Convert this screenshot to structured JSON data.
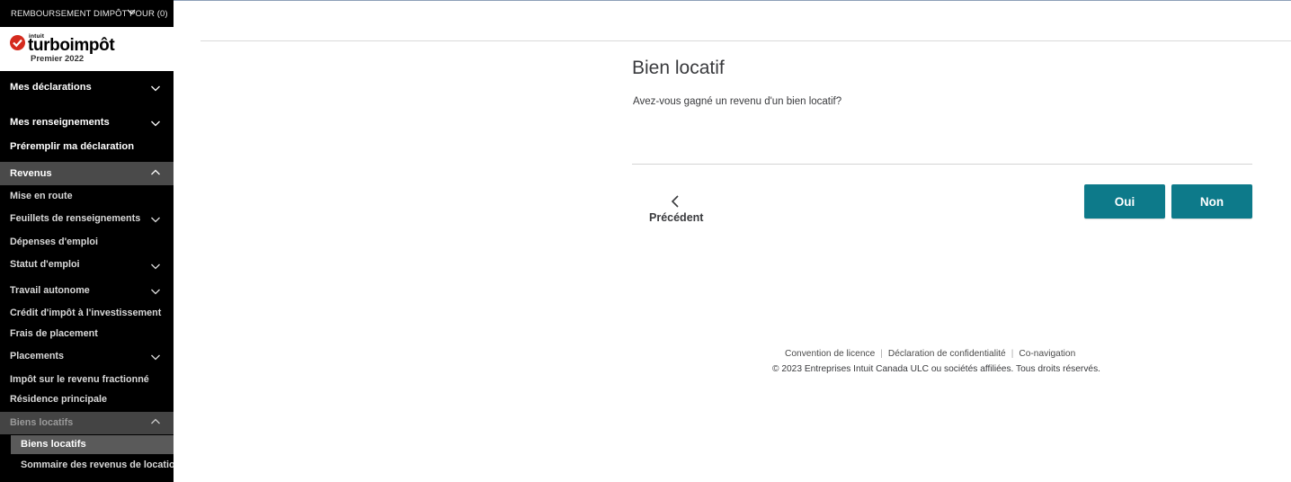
{
  "sidebar": {
    "refund_label": "REMBOURSEMENT DIMPÔT POUR (0)",
    "brand": {
      "company": "intuit",
      "product": "turboimpôt",
      "edition": "Premier 2022"
    },
    "items": [
      {
        "label": "Mes déclarations"
      },
      {
        "label": "Mes renseignements"
      },
      {
        "label": "Préremplir ma déclaration"
      },
      {
        "label": "Revenus"
      },
      {
        "label": "Mise en route"
      },
      {
        "label": "Feuillets de renseignements"
      },
      {
        "label": "Dépenses d'emploi"
      },
      {
        "label": "Statut d'emploi"
      },
      {
        "label": "Travail autonome"
      },
      {
        "label": "Crédit d'impôt à l'investissement"
      },
      {
        "label": "Frais de placement"
      },
      {
        "label": "Placements"
      },
      {
        "label": "Impôt sur le revenu fractionné"
      },
      {
        "label": "Résidence principale"
      },
      {
        "label": "Biens locatifs"
      },
      {
        "label": "Biens locatifs"
      },
      {
        "label": "Sommaire des revenus de location"
      }
    ]
  },
  "main": {
    "title": "Bien locatif",
    "question": "Avez-vous gagné un revenu d'un bien locatif?",
    "previous_label": "Précédent",
    "yes_label": "Oui",
    "no_label": "Non"
  },
  "footer": {
    "links": [
      "Convention de licence",
      "Déclaration de confidentialité",
      "Co-navigation"
    ],
    "copyright": "© 2023 Entreprises Intuit Canada ULC ou sociétés affiliées. Tous droits réservés."
  },
  "colors": {
    "primary_button": "#0d7a8a",
    "sidebar_bg": "#000000",
    "brand_check": "#d52b1e"
  }
}
